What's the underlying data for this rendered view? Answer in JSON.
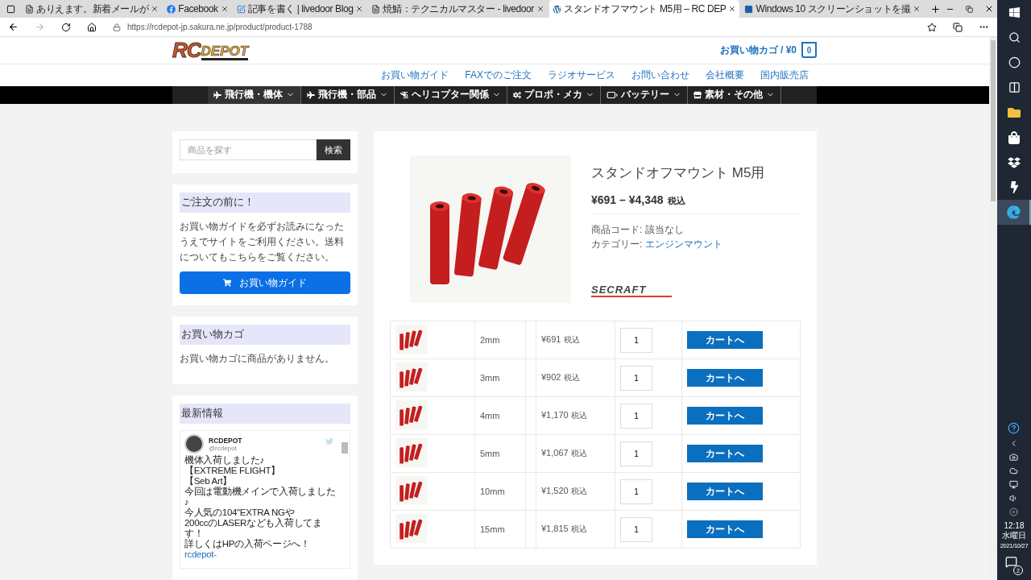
{
  "browser": {
    "tabs": [
      {
        "title": "ありえます。新着メールが",
        "selected": false
      },
      {
        "title": "Facebook",
        "selected": false
      },
      {
        "title": "記事を書く | livedoor Blog",
        "selected": false
      },
      {
        "title": "焼鯖：テクニカルマスター - livedoor",
        "selected": false
      },
      {
        "title": "スタンドオフマウント M5用 – RC DEP",
        "selected": true
      },
      {
        "title": "Windows 10 スクリーンショットを撮",
        "selected": false
      }
    ],
    "url": "https://rcdepot-jp.sakura.ne.jp/product/product-1788"
  },
  "header": {
    "logo": {
      "part_1": "RC",
      "part_2": "DEPOT"
    },
    "cart_label": "お買い物カゴ / ¥0",
    "cart_count": "0",
    "top_nav": [
      "お買い物ガイド",
      "FAXでのご注文",
      "ラジオサービス",
      "お問い合わせ",
      "会社概要",
      "国内販売店"
    ],
    "menu": [
      {
        "label": "飛行機・機体",
        "kind": "plane",
        "selected": true
      },
      {
        "label": "飛行機・部品",
        "kind": "plane",
        "selected": false
      },
      {
        "label": "ヘリコプター関係",
        "kind": "helicopter",
        "selected": false
      },
      {
        "label": "プロポ・メカ",
        "kind": "gears",
        "selected": false
      },
      {
        "label": "バッテリー",
        "kind": "battery",
        "selected": false
      },
      {
        "label": "素材・その他",
        "kind": "store",
        "selected": false
      }
    ]
  },
  "sidebar": {
    "search": {
      "placeholder": "商品を探す",
      "button": "検索"
    },
    "notice": {
      "title": "ご注文の前に！",
      "text": "お買い物ガイドを必ずお読みになったうえでサイトをご利用ください。送料についてもこちらをご覧ください。",
      "button": "お買い物ガイド"
    },
    "cart": {
      "title": "お買い物カゴ",
      "text": "お買い物カゴに商品がありません。"
    },
    "news": {
      "title": "最新情報",
      "name": "RCDEPOT",
      "handle": "@rcdepot",
      "lines": [
        "機体入荷しました♪",
        "【EXTREME FLIGHT】",
        "【Seb Art】",
        "今回は電動機メインで入荷しました♪",
        "今人気の104\"EXTRA NGや",
        "200ccのLASERなども入荷してます！",
        "詳しくはHPの入荷ページへ！"
      ],
      "link": "rcdepot-"
    }
  },
  "product": {
    "title": "スタンドオフマウント M5用",
    "price": "¥691 – ¥4,348",
    "tax": "税込",
    "sku": "商品コード: 該当なし",
    "category_label": "カテゴリー:",
    "category": "エンジンマウント",
    "brand": "SECRAFT",
    "variants": [
      {
        "size": "2mm",
        "price": "¥691",
        "tax": "税込",
        "qty": "1",
        "button": "カートへ"
      },
      {
        "size": "3mm",
        "price": "¥902",
        "tax": "税込",
        "qty": "1",
        "button": "カートへ"
      },
      {
        "size": "4mm",
        "price": "¥1,170",
        "tax": "税込",
        "qty": "1",
        "button": "カートへ"
      },
      {
        "size": "5mm",
        "price": "¥1,067",
        "tax": "税込",
        "qty": "1",
        "button": "カートへ"
      },
      {
        "size": "10mm",
        "price": "¥1,520",
        "tax": "税込",
        "qty": "1",
        "button": "カートへ"
      },
      {
        "size": "15mm",
        "price": "¥1,815",
        "tax": "税込",
        "qty": "1",
        "button": "カートへ"
      }
    ]
  },
  "taskbar": {
    "apps": [
      {
        "kind": "windows",
        "selected": false
      },
      {
        "kind": "search",
        "selected": false
      },
      {
        "kind": "cortana",
        "selected": false
      },
      {
        "kind": "taskview",
        "selected": false
      },
      {
        "kind": "folder",
        "selected": false
      },
      {
        "kind": "store",
        "selected": false
      },
      {
        "kind": "dropbox",
        "selected": false
      },
      {
        "kind": "bolt",
        "selected": false
      },
      {
        "kind": "edge",
        "selected": true
      }
    ],
    "time": "12:18",
    "day": "水曜日",
    "date": "2021/10/27",
    "notifications": "2"
  }
}
